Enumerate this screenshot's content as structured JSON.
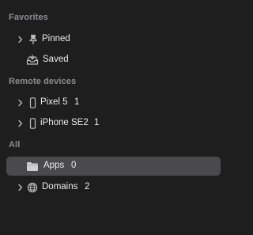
{
  "sidebar": {
    "favorites": {
      "header": "Favorites",
      "items": [
        {
          "label": "Pinned",
          "icon": "pin-icon"
        },
        {
          "label": "Saved",
          "icon": "tray-icon"
        }
      ]
    },
    "remote_devices": {
      "header": "Remote devices",
      "items": [
        {
          "label": "Pixel 5",
          "count": "1",
          "icon": "phone-icon"
        },
        {
          "label": "iPhone SE2",
          "count": "1",
          "icon": "phone-icon"
        }
      ]
    },
    "all": {
      "header": "All",
      "items": [
        {
          "label": "Apps",
          "count": "0",
          "icon": "folder-icon",
          "selected": true
        },
        {
          "label": "Domains",
          "count": "2",
          "icon": "globe-icon"
        }
      ]
    }
  },
  "colors": {
    "background": "#1e1e1f",
    "header_text": "#8e8e90",
    "item_text": "#ececec",
    "selection": "#4a4a4c",
    "icon": "#bdbdbd"
  }
}
